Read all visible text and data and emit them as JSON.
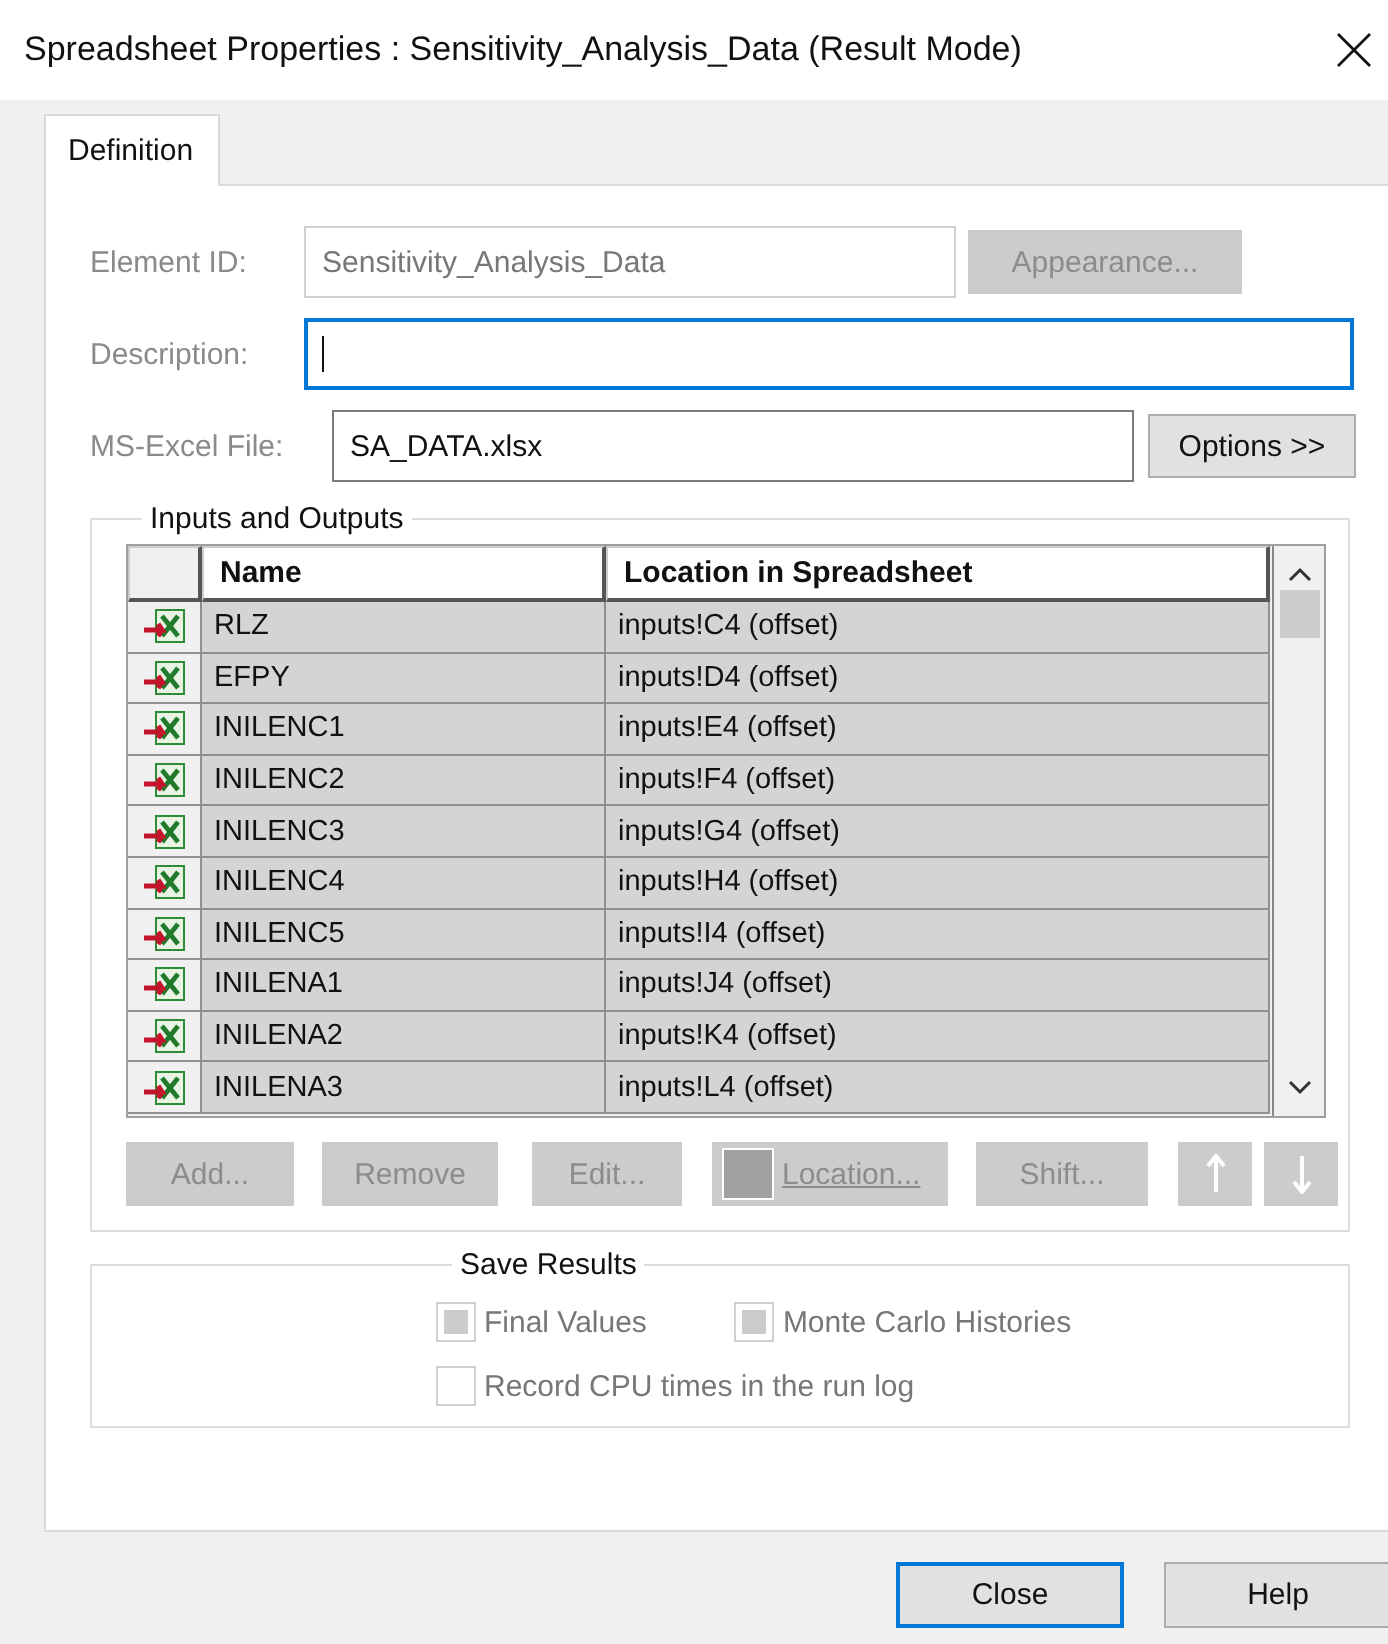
{
  "window": {
    "title": "Spreadsheet Properties : Sensitivity_Analysis_Data (Result Mode)"
  },
  "tabs": [
    {
      "label": "Definition",
      "selected": true
    }
  ],
  "element_id": {
    "label": "Element ID:",
    "value": "Sensitivity_Analysis_Data",
    "disabled": true
  },
  "appearance_button": {
    "label": "Appearance...",
    "disabled": true
  },
  "description": {
    "label": "Description:",
    "focused": true
  },
  "excel_file": {
    "label": "MS-Excel File:",
    "value": "SA_DATA.xlsx"
  },
  "options_button": {
    "label": "Options >>",
    "disabled": false
  },
  "inputs_outputs": {
    "title": "Inputs and Outputs",
    "columns": [
      "Name",
      "Location in Spreadsheet"
    ],
    "rows": [
      {
        "name": "RLZ",
        "location": "inputs!C4 (offset)"
      },
      {
        "name": "EFPY",
        "location": "inputs!D4 (offset)"
      },
      {
        "name": "INILENC1",
        "location": "inputs!E4 (offset)"
      },
      {
        "name": "INILENC2",
        "location": "inputs!F4 (offset)"
      },
      {
        "name": "INILENC3",
        "location": "inputs!G4 (offset)"
      },
      {
        "name": "INILENC4",
        "location": "inputs!H4 (offset)"
      },
      {
        "name": "INILENC5",
        "location": "inputs!I4 (offset)"
      },
      {
        "name": "INILENA1",
        "location": "inputs!J4 (offset)"
      },
      {
        "name": "INILENA2",
        "location": "inputs!K4 (offset)"
      },
      {
        "name": "INILENA3",
        "location": "inputs!L4 (offset)"
      }
    ],
    "buttons": [
      {
        "kind": "text",
        "label": "Add...",
        "disabled": true
      },
      {
        "kind": "text",
        "label": "Remove",
        "disabled": true
      },
      {
        "kind": "text",
        "label": "Edit...",
        "disabled": true
      },
      {
        "kind": "swatch",
        "label": "Location...",
        "disabled": true
      },
      {
        "kind": "text",
        "label": "Shift...",
        "disabled": true
      },
      {
        "kind": "up",
        "disabled": true
      },
      {
        "kind": "down",
        "disabled": true
      }
    ]
  },
  "save_results": {
    "title": "Save Results",
    "options": [
      {
        "label": "Final Values",
        "checked": true,
        "disabled": true
      },
      {
        "label": "Monte Carlo Histories",
        "checked": true,
        "disabled": true
      },
      {
        "label": "Record CPU times in the run log",
        "checked": false,
        "disabled": true
      }
    ]
  },
  "footer_buttons": [
    {
      "label": "Close",
      "default": true
    },
    {
      "label": "Help",
      "default": false
    }
  ]
}
